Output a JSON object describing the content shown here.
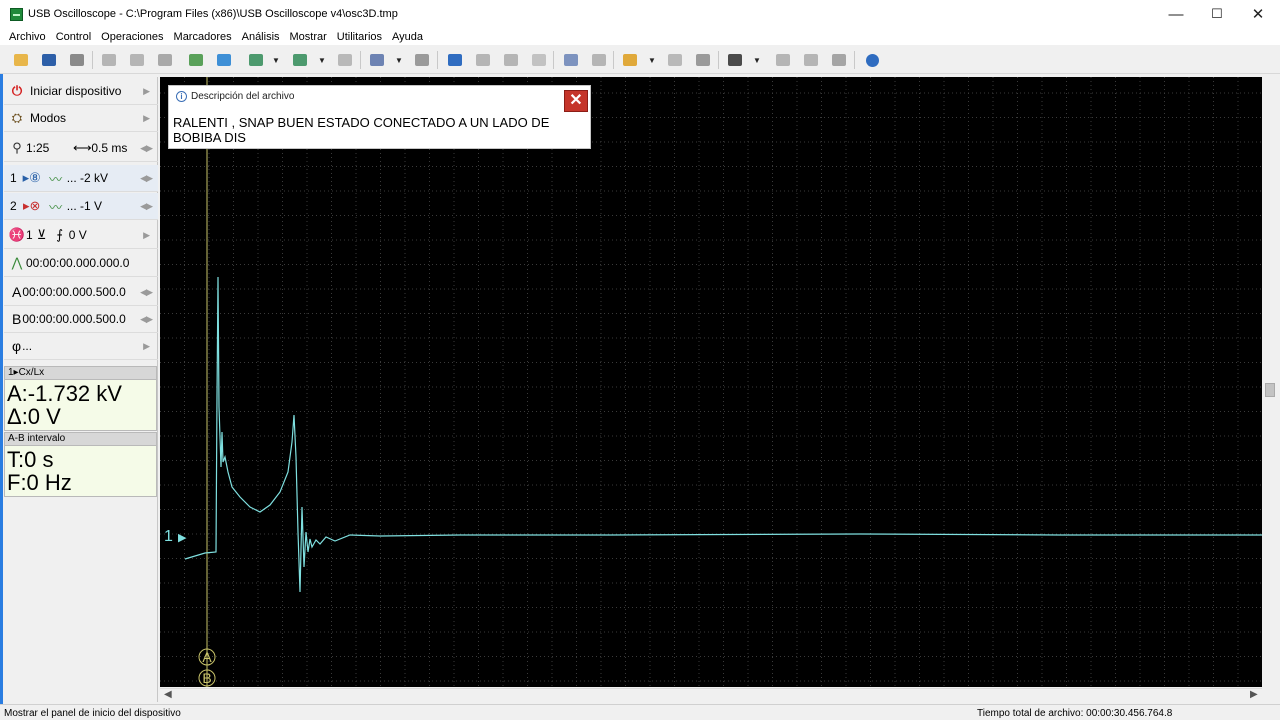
{
  "window": {
    "title": "USB Oscilloscope - C:\\Program Files (x86)\\USB Oscilloscope v4\\osc3D.tmp",
    "minimize": "—",
    "maximize": "☐",
    "close": "✕"
  },
  "menu": [
    "Archivo",
    "Control",
    "Operaciones",
    "Marcadores",
    "Análisis",
    "Mostrar",
    "Utilitarios",
    "Ayuda"
  ],
  "left_panel": {
    "start_device": "Iniciar dispositivo",
    "modes": "Modos",
    "zoom": "1:25",
    "timebase": "0.5 ms",
    "ch1_label": "1",
    "ch1_scale": "... -2 kV",
    "ch2_label": "2",
    "ch2_scale": "... -1 V",
    "trigger_ch": "1",
    "trigger_level": "0 V",
    "trigger_time": "00:00:00.000.000.0",
    "marker_a_label": "A",
    "marker_a_time": "00:00:00.000.500.0",
    "marker_b_label": "B",
    "marker_b_time": "00:00:00.000.500.0",
    "phase_label": "φ",
    "phase_value": "...",
    "cx_header": "1▸Cx/Lx",
    "cx_a": "A:-1.732 kV",
    "cx_delta": "Δ:0 V",
    "ab_header": "A-B intervalo",
    "ab_t": "T:0 s",
    "ab_f": "F:0 Hz"
  },
  "scope": {
    "channel_marker": "1",
    "marker_a": "A",
    "marker_b": "B",
    "trace_color": "#7fe0e0",
    "marker_color": "#c9c46a",
    "grid_color": "#3a3a3a"
  },
  "popup": {
    "title": "Descripción del archivo",
    "text": "RALENTI , SNAP   BUEN  ESTADO CONECTADO A UN LADO DE BOBIBA DIS"
  },
  "status": {
    "left": "Mostrar el panel de inicio del dispositivo",
    "right": "Tiempo total de archivo: 00:00:30.456.764.8"
  }
}
